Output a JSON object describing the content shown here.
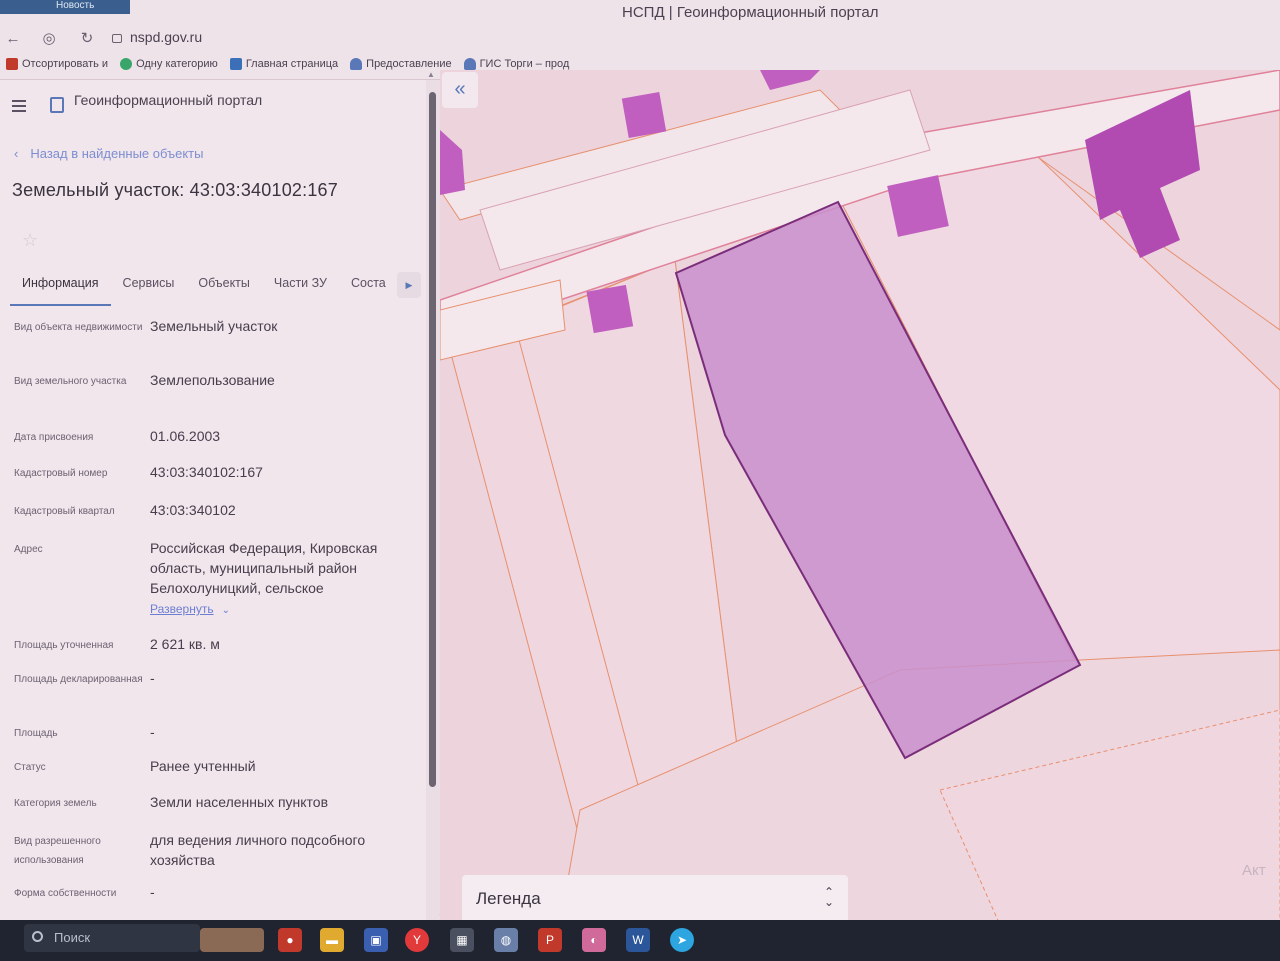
{
  "os": {
    "tab_label": "Новость"
  },
  "browser": {
    "window_title": "НСПД | Геоинформационный портал",
    "url": "nspd.gov.ru",
    "bookmarks": [
      {
        "label": "Отсортировать и",
        "color": "#c0392b"
      },
      {
        "label": "Одну категорию",
        "color": "#3aa56a"
      },
      {
        "label": "Главная страница",
        "color": "#3b6fb8"
      },
      {
        "label": "Предоставление",
        "color": "#5a78b8"
      },
      {
        "label": "ГИС Торги – прод",
        "color": "#5a78b8"
      }
    ]
  },
  "header": {
    "portal_title": "Геоинформационный портал"
  },
  "nav": {
    "back_label": "Назад в найденные объекты"
  },
  "object": {
    "title": "Земельный участок: 43:03:340102:167"
  },
  "tabs": [
    {
      "label": "Информация",
      "active": true
    },
    {
      "label": "Сервисы",
      "active": false
    },
    {
      "label": "Объекты",
      "active": false
    },
    {
      "label": "Части ЗУ",
      "active": false
    },
    {
      "label": "Соста",
      "active": false
    }
  ],
  "properties": [
    {
      "label": "Вид объекта недвижимости",
      "value": "Земельный участок"
    },
    {
      "label": "Вид земельного участка",
      "value": "Землепользование"
    },
    {
      "label": "Дата присвоения",
      "value": "01.06.2003"
    },
    {
      "label": "Кадастровый номер",
      "value": "43:03:340102:167"
    },
    {
      "label": "Кадастровый квартал",
      "value": "43:03:340102"
    },
    {
      "label": "Адрес",
      "value": "Российская Федерация, Кировская область, муниципальный район Белохолуницкий, сельское",
      "expand_label": "Развернуть"
    },
    {
      "label": "Площадь уточненная",
      "value": "2 621 кв. м"
    },
    {
      "label": "Площадь декларированная",
      "value": "-"
    },
    {
      "label": "Площадь",
      "value": "-"
    },
    {
      "label": "Статус",
      "value": "Ранее учтенный"
    },
    {
      "label": "Категория земель",
      "value": "Земли населенных пунктов"
    },
    {
      "label": "Вид разрешенного использования",
      "value": "для ведения личного подсобного хозяйства"
    },
    {
      "label": "Форма собственности",
      "value": "-"
    }
  ],
  "map": {
    "legend_label": "Легенда",
    "watermark": "Акт",
    "colors": {
      "parcel_fill": "#c98fcc",
      "parcel_stroke": "#7a2d7a",
      "building": "#c05fbf",
      "boundary": "#e7906e"
    }
  },
  "taskbar": {
    "search_placeholder": "Поиск"
  }
}
